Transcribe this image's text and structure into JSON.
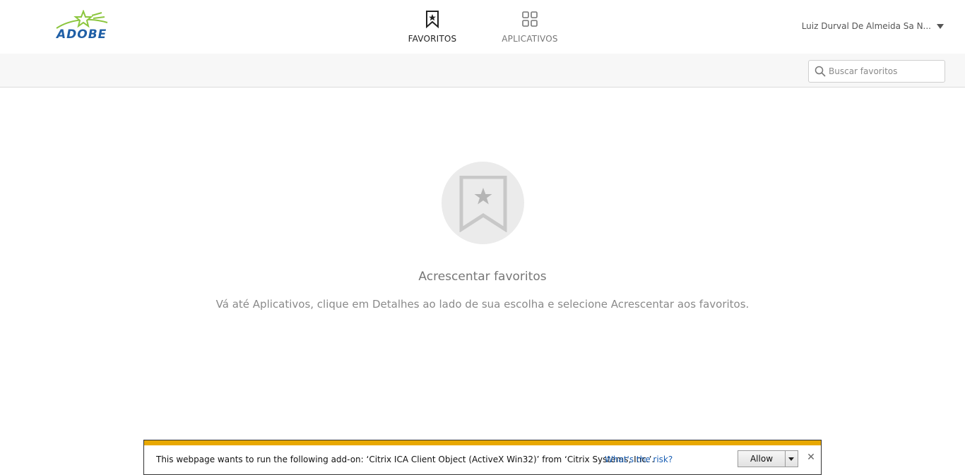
{
  "header": {
    "logo_text": "ADOBE",
    "tabs": [
      {
        "label": "FAVORITOS",
        "icon": "bookmark-star-icon",
        "active": true
      },
      {
        "label": "APLICATIVOS",
        "icon": "grid-icon",
        "active": false
      }
    ],
    "user_name": "Luiz Durval De Almeida Sa N..."
  },
  "search": {
    "placeholder": "Buscar favoritos",
    "value": ""
  },
  "empty_state": {
    "icon": "bookmark-star-icon",
    "title": "Acrescentar favoritos",
    "description": "Vá até Aplicativos, clique em Detalhes ao lado de sua escolha e selecione Acrescentar aos favoritos."
  },
  "notification": {
    "message": "This webpage wants to run the following add-on: ‘Citrix ICA Client Object (ActiveX Win32)’ from ‘Citrix Systems, Inc.’.",
    "link_label": "What's the risk?",
    "allow_label": "Allow",
    "accent_color": "#e8a800"
  },
  "colors": {
    "logo_blue": "#1f5fa6",
    "logo_green": "#8cc63f",
    "link_blue": "#1a5fb4"
  }
}
